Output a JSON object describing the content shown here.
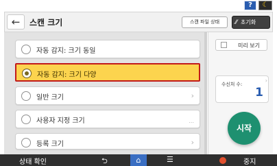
{
  "top": {
    "help_label": "?",
    "moon_icon": "moon-icon"
  },
  "header": {
    "back_icon": "←",
    "title": "스캔 크기",
    "scan_file_status_label": "스캔 파일 상태",
    "reset_label": "초기화",
    "reset_icon": "pencil-slash-icon"
  },
  "options": [
    {
      "label": "자동 감지: 크기 동일",
      "selected": false,
      "suffix": ""
    },
    {
      "label": "자동 감지: 크기 다양",
      "selected": true,
      "suffix": ""
    },
    {
      "label": "일반 크기",
      "selected": false,
      "suffix": "›"
    },
    {
      "label": "사용자 지정 크기",
      "selected": false,
      "suffix": "..."
    },
    {
      "label": "등록 크기",
      "selected": false,
      "suffix": "›"
    }
  ],
  "side": {
    "preview_label": "미리 보기",
    "recipients_label": "수신처 수:",
    "recipients_count": "1",
    "start_label": "시작"
  },
  "bottom": {
    "status_check_label": "상태 확인",
    "stop_label": "중지"
  },
  "colors": {
    "selected_bg": "#fcd44e",
    "selected_border": "#c21a1a",
    "start_button": "#1e9070",
    "home_button": "#3a6ec2",
    "recipients_value": "#2a5db0"
  }
}
